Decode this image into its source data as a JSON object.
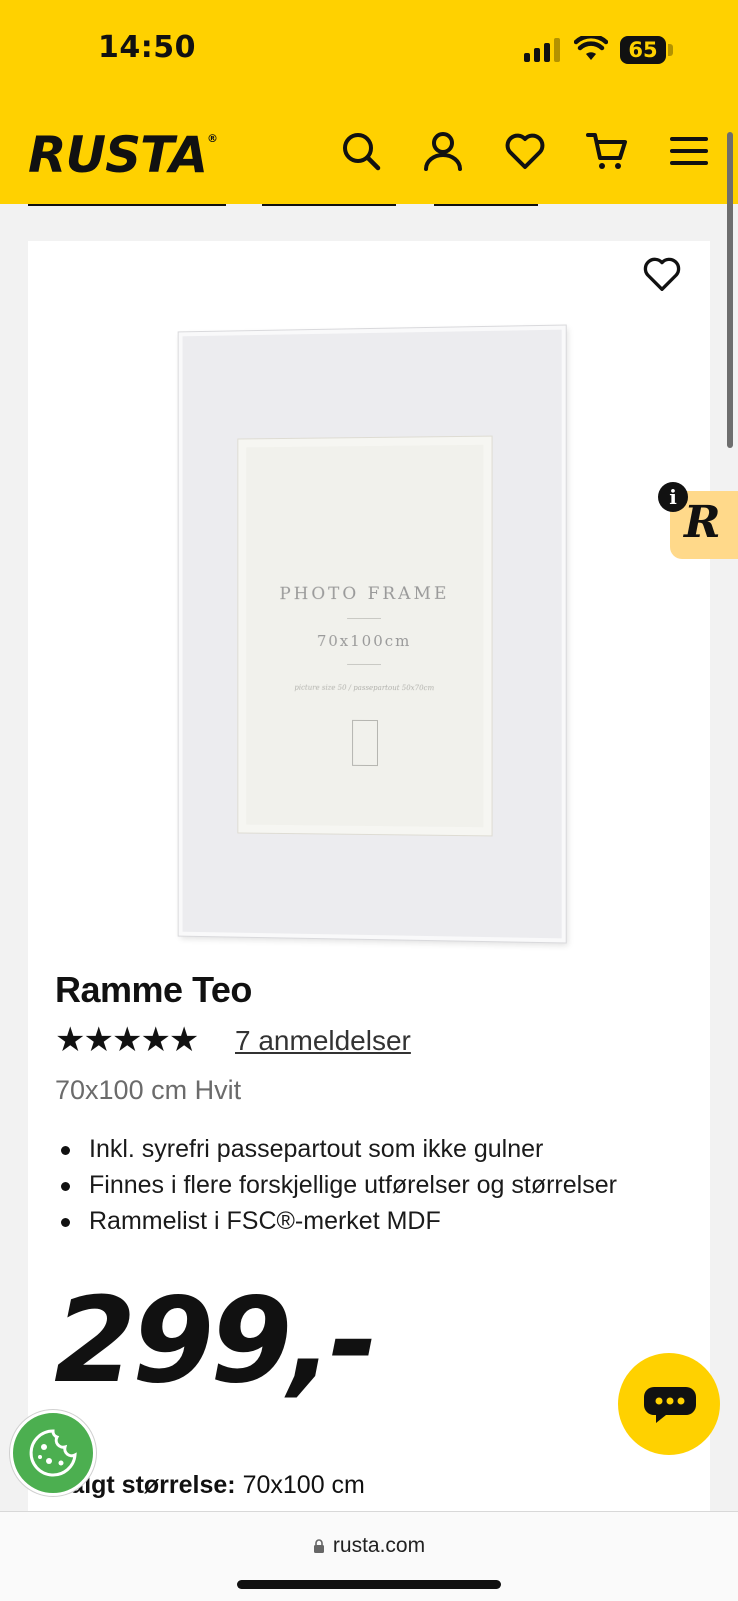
{
  "status_bar": {
    "time": "14:50",
    "battery": "65"
  },
  "header": {
    "logo": "RUSTA",
    "logo_mark": "®",
    "icons": [
      "search-icon",
      "account-icon",
      "favorites-icon",
      "cart-icon",
      "menu-icon"
    ],
    "background_color": "#ffd100"
  },
  "product": {
    "image_text": {
      "title": "PHOTO FRAME",
      "size": "70x100cm",
      "small_print": "picture size 50 / passepartout 50x70cm"
    },
    "title": "Ramme Teo",
    "rating": {
      "stars": 5,
      "display": "★★★★★"
    },
    "reviews_label": "7 anmeldelser",
    "variant": "70x100 cm Hvit",
    "features": [
      "Inkl. syrefri passepartout som ikke gulner",
      "Finnes i flere forskjellige utførelser og størrelser",
      "Rammelist i FSC®-merket MDF"
    ],
    "price": "299,-",
    "selected_size_label": "Valgt størrelse:",
    "selected_size_value": "70x100 cm"
  },
  "widgets": {
    "side_widget_letter": "R",
    "info_badge": "i"
  },
  "browser": {
    "url": "rusta.com"
  }
}
